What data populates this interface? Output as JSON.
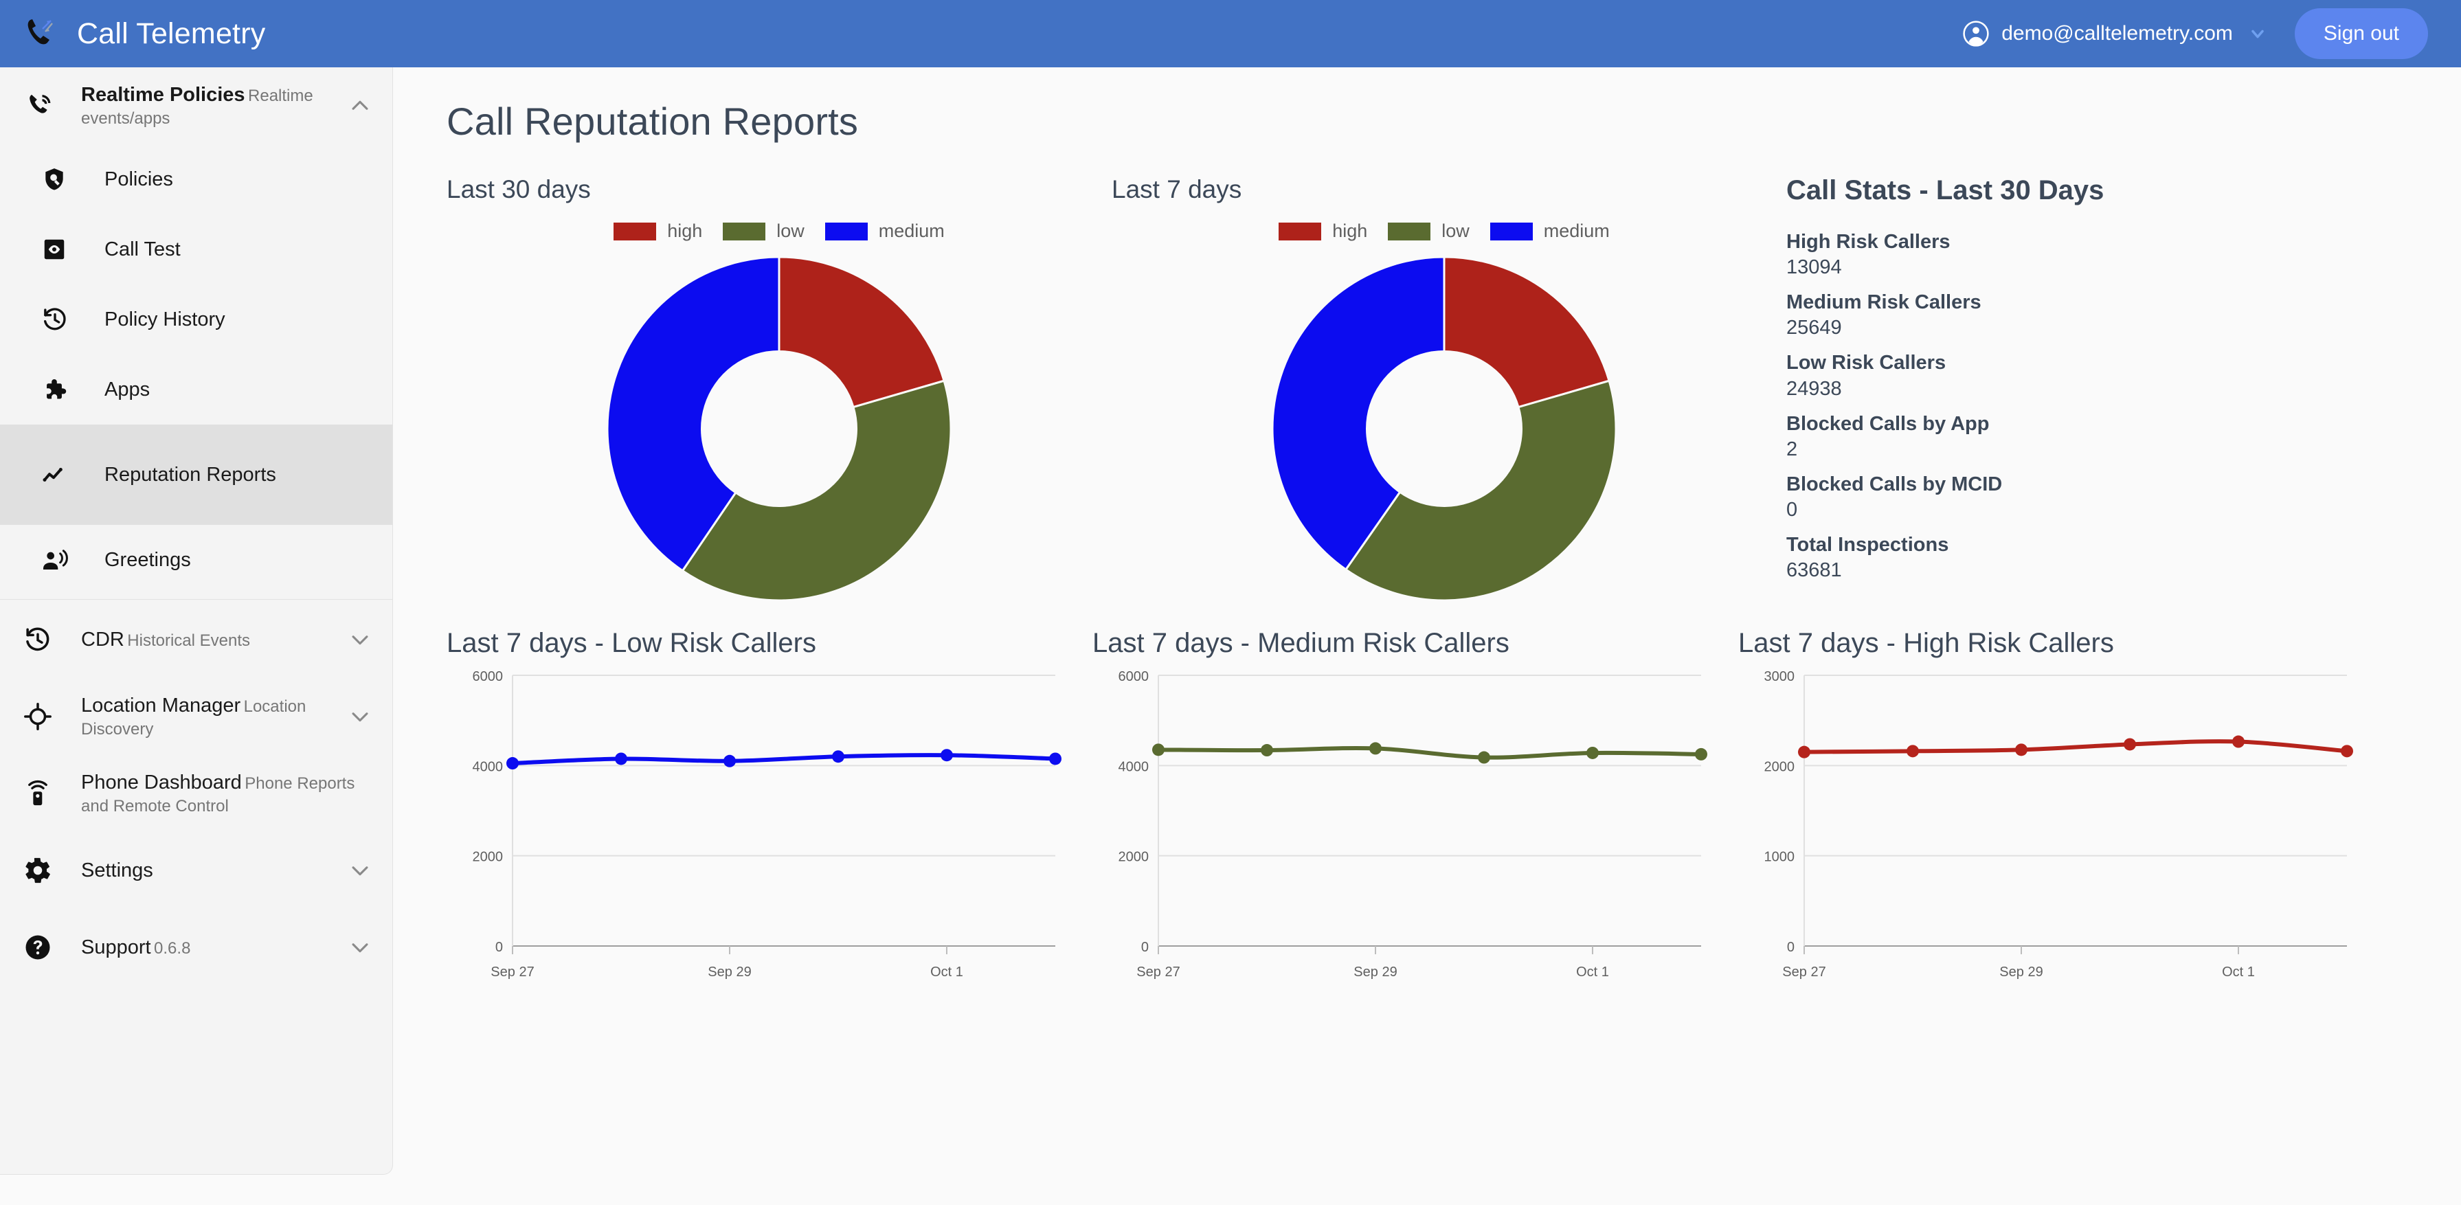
{
  "app": {
    "brand_title": "Call Telemetry",
    "brand_logo_icon": "phone-telemetry-logo",
    "account_email": "demo@calltelemetry.com",
    "account_icon": "account-circle-icon",
    "account_caret_icon": "chevron-down-icon",
    "signout_label": "Sign out",
    "header_color": "#4272C4",
    "signout_color": "#5C85EE"
  },
  "sidebar": {
    "items": [
      {
        "label": "Realtime Policies",
        "sub": "Realtime events/apps",
        "icon": "phone-ring-icon",
        "chevron": "chevron-up-icon",
        "type": "group",
        "selected": false
      },
      {
        "label": "Policies",
        "icon": "shield-search-icon",
        "type": "sub",
        "selected": false
      },
      {
        "label": "Call Test",
        "icon": "eye-square-icon",
        "type": "sub",
        "selected": false
      },
      {
        "label": "Policy History",
        "icon": "history-clock-icon",
        "type": "sub",
        "selected": false
      },
      {
        "label": "Apps",
        "icon": "puzzle-piece-icon",
        "type": "sub",
        "selected": false
      },
      {
        "label": "Reputation Reports",
        "icon": "line-chart-icon",
        "type": "sub",
        "selected": true
      },
      {
        "label": "Greetings",
        "icon": "person-speaking-icon",
        "type": "sub",
        "selected": false
      },
      {
        "label": "CDR",
        "sub": "Historical Events",
        "icon": "history-clock-icon",
        "chevron": "chevron-down-icon",
        "type": "group",
        "selected": false
      },
      {
        "label": "Location Manager",
        "sub": "Location Discovery",
        "icon": "crosshair-icon",
        "chevron": "chevron-down-icon",
        "type": "group",
        "selected": false
      },
      {
        "label": "Phone Dashboard",
        "sub": "Phone Reports and Remote Control",
        "icon": "remote-phone-icon",
        "type": "group",
        "selected": false
      },
      {
        "label": "Settings",
        "icon": "gear-icon",
        "chevron": "chevron-down-icon",
        "type": "group",
        "selected": false
      },
      {
        "label": "Support",
        "sub": "0.6.8",
        "icon": "help-circle-icon",
        "chevron": "chevron-down-icon",
        "type": "group",
        "selected": false
      }
    ]
  },
  "main": {
    "page_title": "Call Reputation Reports",
    "donut_30_title": "Last 30 days",
    "donut_7_title": "Last 7 days"
  },
  "stats": {
    "title": "Call Stats - Last 30 Days",
    "rows": [
      {
        "label": "High Risk Callers",
        "value": "13094"
      },
      {
        "label": "Medium Risk Callers",
        "value": "25649"
      },
      {
        "label": "Low Risk Callers",
        "value": "24938"
      },
      {
        "label": "Blocked Calls by App",
        "value": "2"
      },
      {
        "label": "Blocked Calls by MCID",
        "value": "0"
      },
      {
        "label": "Total Inspections",
        "value": "63681"
      }
    ]
  },
  "colors": {
    "high": "#AE221A",
    "low": "#5A6B30",
    "medium": "#0C0CF0"
  },
  "chart_data": [
    {
      "type": "pie",
      "id": "donut-last-30-days",
      "title": "Last 30 days",
      "labels": [
        "high",
        "low",
        "medium"
      ],
      "values": [
        20.5,
        39.0,
        40.5
      ],
      "colors": [
        "#AE221A",
        "#5A6B30",
        "#0C0CF0"
      ],
      "legend_position": "top",
      "donut": true,
      "inner_radius_ratio": 0.45
    },
    {
      "type": "pie",
      "id": "donut-last-7-days",
      "title": "Last 7 days",
      "labels": [
        "high",
        "low",
        "medium"
      ],
      "values": [
        20.5,
        39.2,
        40.3
      ],
      "colors": [
        "#AE221A",
        "#5A6B30",
        "#0C0CF0"
      ],
      "legend_position": "top",
      "donut": true,
      "inner_radius_ratio": 0.45
    },
    {
      "type": "line",
      "id": "low-risk-7-days",
      "title": "Last 7 days - Low Risk Callers",
      "color": "#0C0CF0",
      "x": [
        "Sep 27",
        "Sep 28",
        "Sep 29",
        "Sep 30",
        "Oct 1",
        "Oct 2"
      ],
      "values": [
        4050,
        4150,
        4100,
        4200,
        4230,
        4150
      ],
      "xtick_labels": [
        "Sep 27",
        "Sep 29",
        "Oct 1"
      ],
      "xtick_indices": [
        0,
        2,
        4
      ],
      "ylim": [
        0,
        6000
      ],
      "yticks": [
        0,
        2000,
        4000,
        6000
      ],
      "ylabel": "",
      "xlabel": "",
      "grid": true
    },
    {
      "type": "line",
      "id": "medium-risk-7-days",
      "title": "Last 7 days - Medium Risk Callers",
      "color": "#5A6B30",
      "x": [
        "Sep 27",
        "Sep 28",
        "Sep 29",
        "Sep 30",
        "Oct 1",
        "Oct 2"
      ],
      "values": [
        4350,
        4340,
        4380,
        4180,
        4280,
        4250
      ],
      "xtick_labels": [
        "Sep 27",
        "Sep 29",
        "Oct 1"
      ],
      "xtick_indices": [
        0,
        2,
        4
      ],
      "ylim": [
        0,
        6000
      ],
      "yticks": [
        0,
        2000,
        4000,
        6000
      ],
      "ylabel": "",
      "xlabel": "",
      "grid": true
    },
    {
      "type": "line",
      "id": "high-risk-7-days",
      "title": "Last 7 days - High Risk Callers",
      "color": "#B5241C",
      "x": [
        "Sep 27",
        "Sep 28",
        "Sep 29",
        "Sep 30",
        "Oct 1",
        "Oct 2"
      ],
      "values": [
        2150,
        2160,
        2175,
        2235,
        2265,
        2160
      ],
      "xtick_labels": [
        "Sep 27",
        "Sep 29",
        "Oct 1"
      ],
      "xtick_indices": [
        0,
        2,
        4
      ],
      "ylim": [
        0,
        3000
      ],
      "yticks": [
        0,
        1000,
        2000,
        3000
      ],
      "ylabel": "",
      "xlabel": "",
      "grid": true
    }
  ]
}
